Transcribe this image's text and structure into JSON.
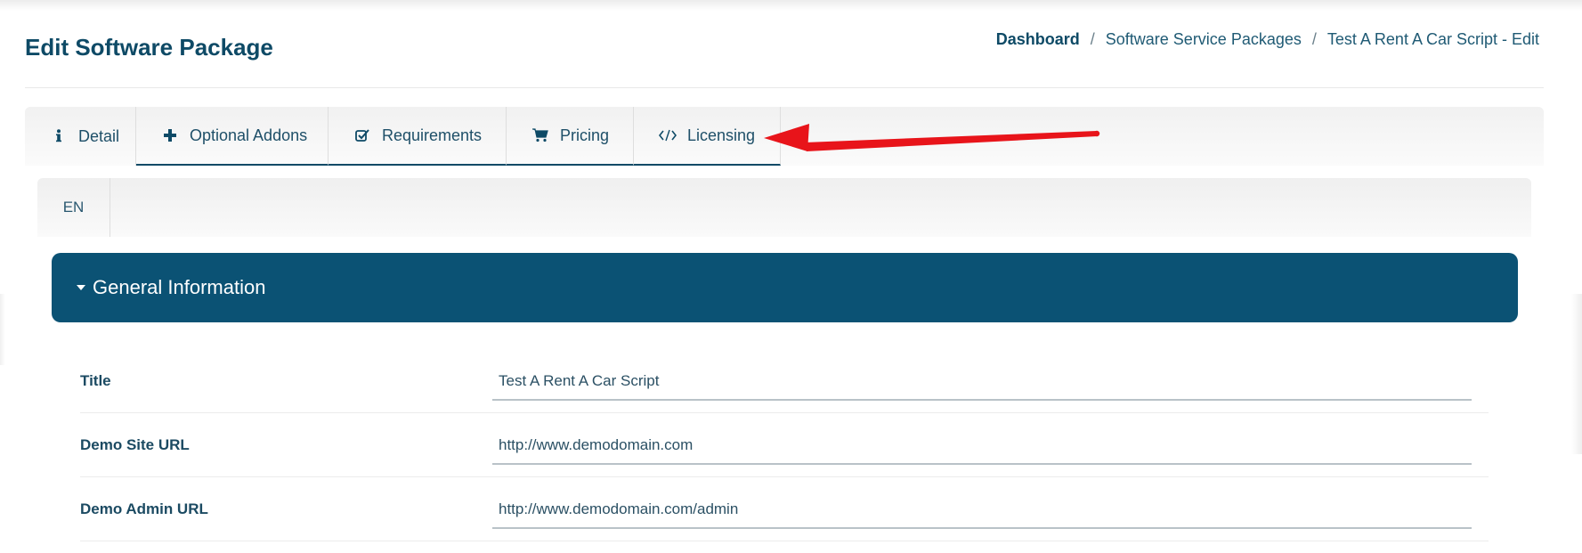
{
  "page": {
    "title": "Edit Software Package"
  },
  "breadcrumb": {
    "items": [
      "Dashboard",
      "Software Service Packages",
      "Test A Rent A Car Script - Edit"
    ],
    "separator": "/"
  },
  "tabs": [
    {
      "label": "Detail",
      "icon": "info-icon"
    },
    {
      "label": "Optional Addons",
      "icon": "plus-icon"
    },
    {
      "label": "Requirements",
      "icon": "check-square-icon"
    },
    {
      "label": "Pricing",
      "icon": "cart-icon"
    },
    {
      "label": "Licensing",
      "icon": "code-icon"
    }
  ],
  "language_tab": {
    "label": "EN"
  },
  "panel": {
    "title": "General Information",
    "icon": "caret-down-icon"
  },
  "form": {
    "fields": [
      {
        "label": "Title",
        "value": "Test A Rent A Car Script"
      },
      {
        "label": "Demo Site URL",
        "value": "http://www.demodomain.com"
      },
      {
        "label": "Demo Admin URL",
        "value": "http://www.demodomain.com/admin"
      }
    ]
  },
  "annotation": {
    "color": "#e8141a",
    "icon": "red-arrow"
  },
  "colors": {
    "primary": "#0b5274",
    "text": "#0e4a66"
  }
}
